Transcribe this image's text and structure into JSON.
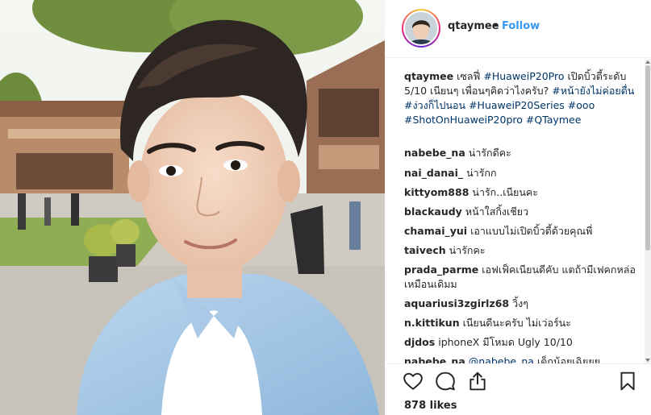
{
  "post": {
    "username": "qtaymee",
    "separator": "•",
    "follow_label": "Follow",
    "likes_text": "878 likes"
  },
  "caption": {
    "username": "qtaymee",
    "text_1": "เซลฟี่",
    "tag_1": "#HuaweiP20Pro",
    "text_2": "เปิดบิ้วตี้ระดับ 5/10 เนียนๆ เพื่อนๆคิดว่าไงครับ?",
    "tag_2": "#หน้ายังไม่ค่อยตื่น",
    "tag_3": "#ง่วงก็ไปนอน",
    "tag_4": "#HuaweiP20Series",
    "tag_5": "#ooo",
    "tag_6": "#ShotOnHuaweiP20pro",
    "tag_7": "#QTaymee"
  },
  "comments": [
    {
      "user": "nabebe_na",
      "text": "น่ารักดีคะ"
    },
    {
      "user": "nai_danai_",
      "text": "น่ารักก"
    },
    {
      "user": "kittyom888",
      "text": "น่ารัก..เนียนคะ"
    },
    {
      "user": "blackaudy",
      "text": "หน้าใสกิ้งเชียว"
    },
    {
      "user": "chamai_yui",
      "text": "เอาแบบไม่เปิดบิ้วตี้ด้วยคุณพี่"
    },
    {
      "user": "taivech",
      "text": "น่ารักคะ"
    },
    {
      "user": "prada_parme",
      "text": "เอฟเฟ็คเนียนดีคับ แตถ้ามีเฟคกหล่อเหมือนเดิมม"
    },
    {
      "user": "aquariusi3zgirlz68",
      "text": "วิ้งๆ"
    },
    {
      "user": "n.kittikun",
      "text": "เนียนดีนะครับ ไม่เว่อร์นะ"
    },
    {
      "user": "djdos",
      "text": "iphoneX มีโหมด Ugly 10/10"
    },
    {
      "user": "nabebe_na",
      "mention": "@nabebe_na",
      "text": "เด็กน้อยเฉิยยย"
    }
  ],
  "icons": {
    "like": "heart-icon",
    "comment": "speech-bubble-icon",
    "share": "share-icon",
    "save": "bookmark-icon"
  },
  "colors": {
    "link_blue": "#3897f0",
    "hashtag": "#003569",
    "text": "#262626"
  }
}
